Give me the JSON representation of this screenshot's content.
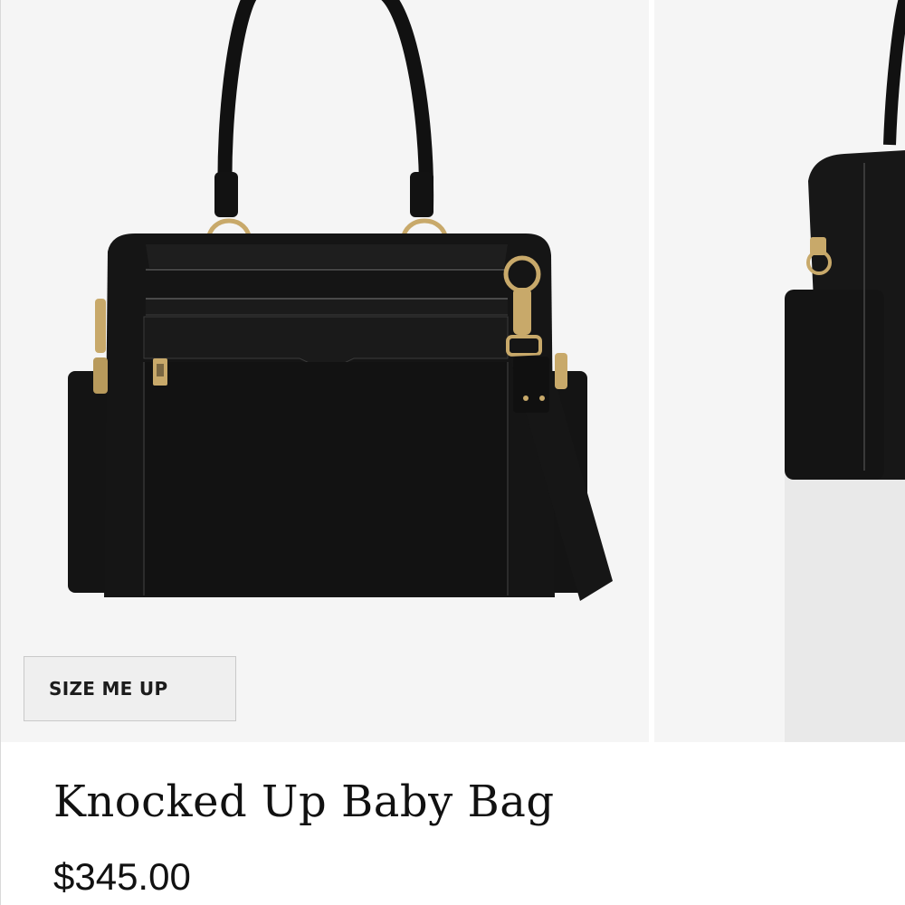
{
  "product": {
    "title": "Knocked Up Baby Bag",
    "price": "$345.00"
  },
  "gallery": {
    "size_button_label": "SIZE ME UP",
    "images": [
      {
        "icon": "black-baby-bag-front-photo"
      },
      {
        "icon": "black-baby-bag-angle-photo"
      }
    ]
  },
  "colors": {
    "background": "#ffffff",
    "image_background": "#f5f5f5",
    "button_background": "#efefef",
    "text": "#111111",
    "bag": "#141414",
    "hardware": "#c8a96a"
  }
}
